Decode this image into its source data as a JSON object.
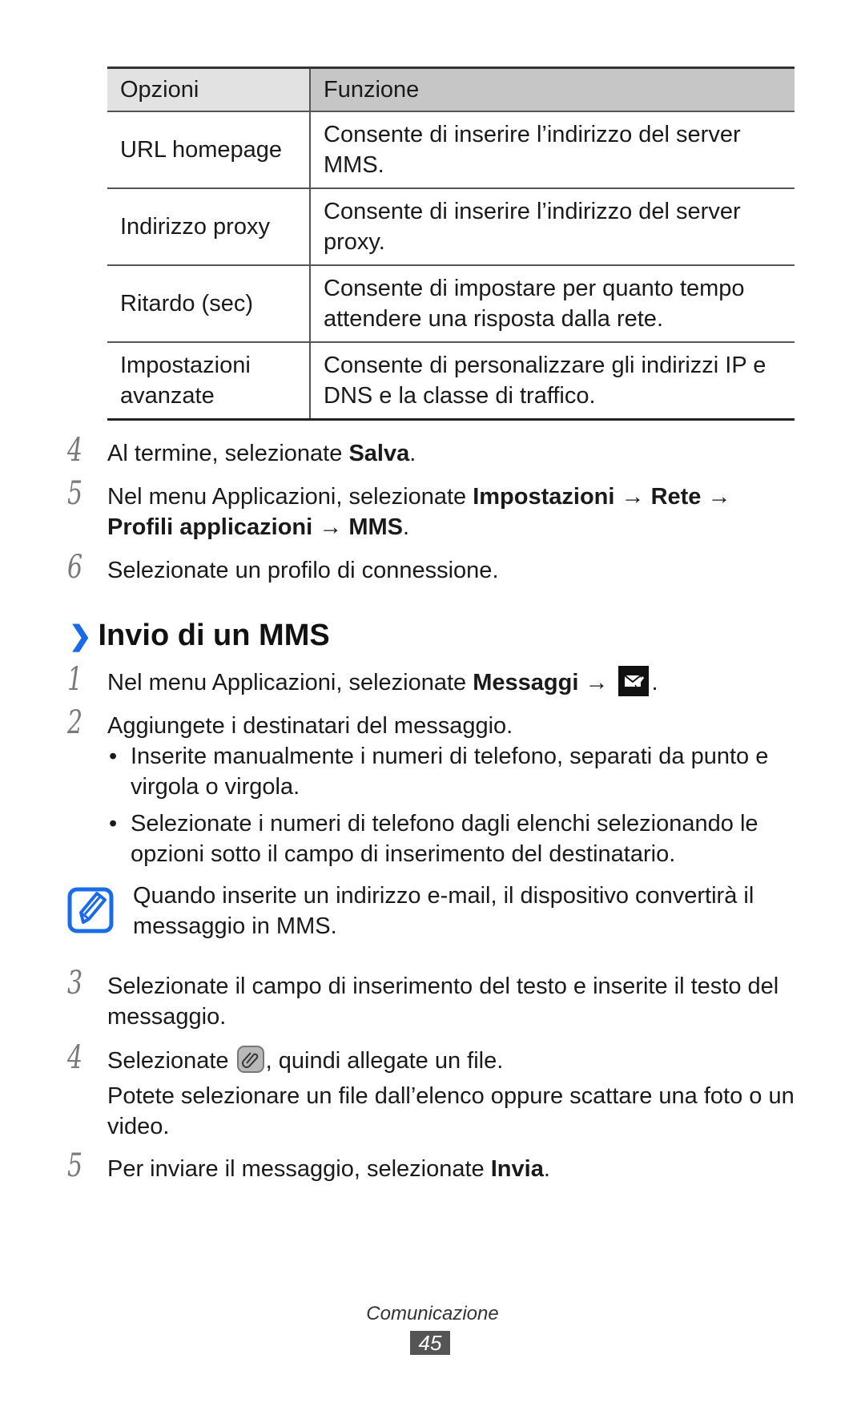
{
  "table": {
    "headers": [
      "Opzioni",
      "Funzione"
    ],
    "rows": [
      {
        "option": "URL homepage",
        "function": "Consente di inserire l’indirizzo del server MMS."
      },
      {
        "option": "Indirizzo proxy",
        "function": "Consente di inserire l’indirizzo del server proxy."
      },
      {
        "option": "Ritardo (sec)",
        "function": "Consente di impostare per quanto tempo attendere una risposta dalla rete."
      },
      {
        "option": "Impostazioni avanzate",
        "function": "Consente di personalizzare gli indirizzi IP e DNS e la classe di traffico."
      }
    ]
  },
  "steps_top": [
    {
      "num": "4",
      "pre": "Al termine, selezionate ",
      "bold": "Salva",
      "post": "."
    },
    {
      "num": "5",
      "pre": "Nel menu Applicazioni, selezionate ",
      "bold1": "Impostazioni",
      "arrow1": " → ",
      "bold2": "Rete",
      "arrow2": " → ",
      "bold3": "Profili applicazioni",
      "arrow3": " → ",
      "bold4": "MMS",
      "post": "."
    },
    {
      "num": "6",
      "text": "Selezionate un profilo di connessione."
    }
  ],
  "section": {
    "chevron": "❯",
    "title": "Invio di un MMS"
  },
  "steps_section": [
    {
      "num": "1",
      "pre": "Nel menu Applicazioni, selezionate ",
      "bold": "Messaggi",
      "arrow": " → ",
      "icon": "compose-message-icon",
      "post": "."
    },
    {
      "num": "2",
      "text": "Aggiungete i destinatari del messaggio."
    },
    {
      "num": "3",
      "text": "Selezionate il campo di inserimento del testo e inserite il testo del messaggio."
    },
    {
      "num": "4",
      "pre": "Selezionate ",
      "icon": "attach-icon",
      "post": ", quindi allegate un file.",
      "detail": "Potete selezionare un file dall’elenco oppure scattare una foto o un video."
    },
    {
      "num": "5",
      "pre": "Per inviare il messaggio, selezionate ",
      "bold": "Invia",
      "post": "."
    }
  ],
  "bullets": [
    "Inserite manualmente i numeri di telefono, separati da punto e virgola o virgola.",
    "Selezionate i numeri di telefono dagli elenchi selezionando le opzioni sotto il campo di inserimento del destinatario."
  ],
  "bullet_glyph": "•",
  "note": {
    "icon": "note-pencil-icon",
    "text": "Quando inserite un indirizzo e-mail, il dispositivo convertirà il messaggio in MMS.",
    "color": "#1a6be8"
  },
  "footer": {
    "section_label": "Comunicazione",
    "page_number": "45"
  }
}
